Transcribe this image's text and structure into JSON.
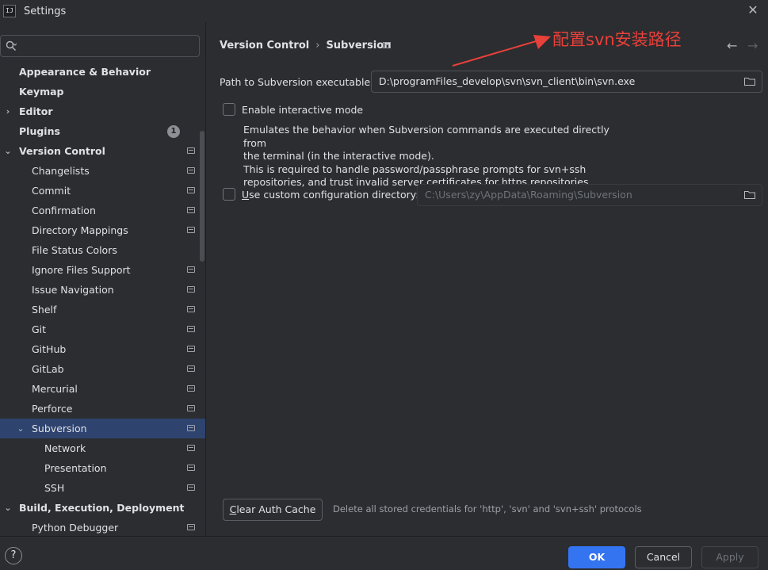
{
  "window": {
    "title": "Settings",
    "logo_text": "IJ"
  },
  "search": {
    "placeholder": "",
    "value": ""
  },
  "sidebar": {
    "items": [
      {
        "label": "Appearance & Behavior",
        "indent": 0,
        "bold": true,
        "arrow": "",
        "project": false
      },
      {
        "label": "Keymap",
        "indent": 0,
        "bold": true,
        "arrow": "",
        "project": false
      },
      {
        "label": "Editor",
        "indent": 0,
        "bold": true,
        "arrow": "›",
        "project": false
      },
      {
        "label": "Plugins",
        "indent": 0,
        "bold": true,
        "arrow": "",
        "project": false,
        "badge": "1"
      },
      {
        "label": "Version Control",
        "indent": 0,
        "bold": true,
        "arrow": "⌄",
        "project": true
      },
      {
        "label": "Changelists",
        "indent": 1,
        "bold": false,
        "arrow": "",
        "project": true
      },
      {
        "label": "Commit",
        "indent": 1,
        "bold": false,
        "arrow": "",
        "project": true
      },
      {
        "label": "Confirmation",
        "indent": 1,
        "bold": false,
        "arrow": "",
        "project": true
      },
      {
        "label": "Directory Mappings",
        "indent": 1,
        "bold": false,
        "arrow": "",
        "project": true
      },
      {
        "label": "File Status Colors",
        "indent": 1,
        "bold": false,
        "arrow": "",
        "project": false
      },
      {
        "label": "Ignore Files Support",
        "indent": 1,
        "bold": false,
        "arrow": "",
        "project": true
      },
      {
        "label": "Issue Navigation",
        "indent": 1,
        "bold": false,
        "arrow": "",
        "project": true
      },
      {
        "label": "Shelf",
        "indent": 1,
        "bold": false,
        "arrow": "",
        "project": true
      },
      {
        "label": "Git",
        "indent": 1,
        "bold": false,
        "arrow": "",
        "project": true
      },
      {
        "label": "GitHub",
        "indent": 1,
        "bold": false,
        "arrow": "",
        "project": true
      },
      {
        "label": "GitLab",
        "indent": 1,
        "bold": false,
        "arrow": "",
        "project": true
      },
      {
        "label": "Mercurial",
        "indent": 1,
        "bold": false,
        "arrow": "",
        "project": true
      },
      {
        "label": "Perforce",
        "indent": 1,
        "bold": false,
        "arrow": "",
        "project": true
      },
      {
        "label": "Subversion",
        "indent": 1,
        "bold": false,
        "arrow": "⌄",
        "project": true,
        "selected": true
      },
      {
        "label": "Network",
        "indent": 2,
        "bold": false,
        "arrow": "",
        "project": true
      },
      {
        "label": "Presentation",
        "indent": 2,
        "bold": false,
        "arrow": "",
        "project": true
      },
      {
        "label": "SSH",
        "indent": 2,
        "bold": false,
        "arrow": "",
        "project": true
      },
      {
        "label": "Build, Execution, Deployment",
        "indent": 0,
        "bold": true,
        "arrow": "⌄",
        "project": false
      },
      {
        "label": "Python Debugger",
        "indent": 1,
        "bold": false,
        "arrow": "",
        "project": true
      }
    ]
  },
  "main": {
    "breadcrumb": {
      "parent": "Version Control",
      "separator": "›",
      "current": "Subversion"
    },
    "annotation": "配置svn安装路径",
    "path_label": "Path to Subversion executable:",
    "path_value": "D:\\programFiles_develop\\svn\\svn_client\\bin\\svn.exe",
    "interactive_label": "Enable interactive mode",
    "interactive_checked": false,
    "interactive_desc": [
      "Emulates the behavior when Subversion commands are executed directly from",
      "the terminal (in the interactive mode).",
      "This is required to handle password/passphrase prompts for svn+ssh",
      "repositories, and trust invalid server certificates for https repositories."
    ],
    "custom_dir_label_mnemonic": "U",
    "custom_dir_label_rest": "se custom configuration directory:",
    "custom_dir_checked": false,
    "custom_dir_value": "C:\\Users\\zy\\AppData\\Roaming\\Subversion",
    "clear_cache_mnemonic": "C",
    "clear_cache_rest": "lear Auth Cache",
    "clear_cache_desc": "Delete all stored credentials for 'http', 'svn' and 'svn+ssh' protocols"
  },
  "footer": {
    "help": "?",
    "ok": "OK",
    "cancel": "Cancel",
    "apply": "Apply"
  },
  "colors": {
    "background": "#2b2d30",
    "selection": "#2e436e",
    "accent": "#3574f0",
    "annotation": "#e8403a"
  },
  "icons": [
    "search-icon",
    "close-icon",
    "chevron-right-icon",
    "chevron-down-icon",
    "project-scope-icon",
    "back-arrow-icon",
    "forward-arrow-icon",
    "folder-icon",
    "help-icon"
  ]
}
